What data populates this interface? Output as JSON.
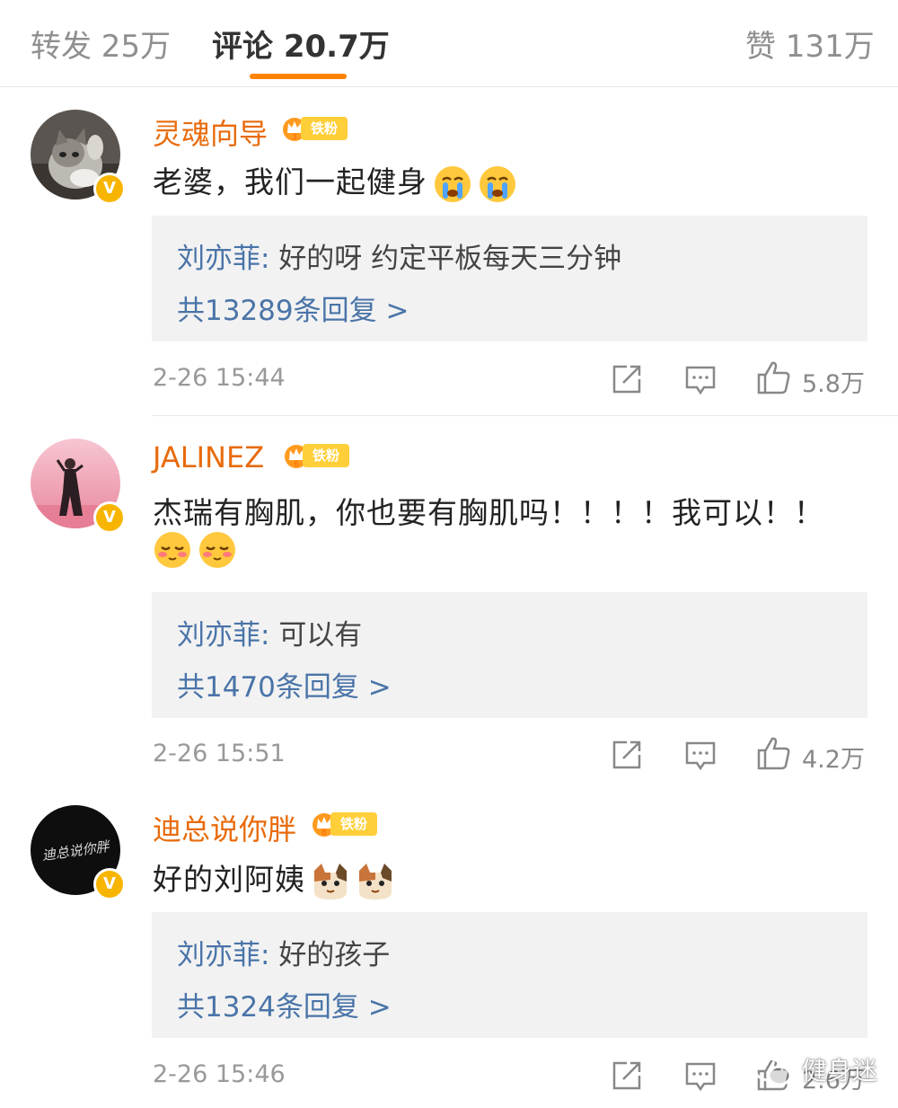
{
  "tabs": [
    {
      "label": "转发 25万"
    },
    {
      "label": "评论 20.7万"
    },
    {
      "label": "赞 131万"
    }
  ],
  "comments": [
    {
      "username": "灵魂向导",
      "badge_level": "3",
      "badge_text": "铁粉",
      "text": "老婆，我们一起健身",
      "text_line2": "",
      "emoji": "crying-emoji",
      "reply_author": "刘亦菲:",
      "reply_text": "好的呀 约定平板每天三分钟",
      "reply_count": "共13289条回复 >",
      "time": "2-26 15:44",
      "likes": "5.8万"
    },
    {
      "username": "JALINEZ",
      "badge_level": "6",
      "badge_text": "铁粉",
      "text": "杰瑞有胸肌，你也要有胸肌吗！！！！我可以！！",
      "text_line2": "",
      "emoji": "blushing-emoji",
      "reply_author": "刘亦菲:",
      "reply_text": "可以有",
      "reply_count": "共1470条回复 >",
      "time": "2-26 15:51",
      "likes": "4.2万"
    },
    {
      "username": "迪总说你胖",
      "badge_level": "6",
      "badge_text": "铁粉",
      "text": "好的刘阿姨",
      "text_line2": "",
      "emoji": "cat-emoji",
      "reply_author": "刘亦菲:",
      "reply_text": "好的孩子",
      "reply_count": "共1324条回复 >",
      "time": "2-26 15:46",
      "likes": "2.6万"
    }
  ],
  "avatar3_text": "迪总说你胖",
  "watermark": "健身迷",
  "colors": {
    "accent": "#ff8200",
    "username": "#e86b0c",
    "link": "#4a74a8",
    "reply_bg": "#f2f2f2"
  }
}
